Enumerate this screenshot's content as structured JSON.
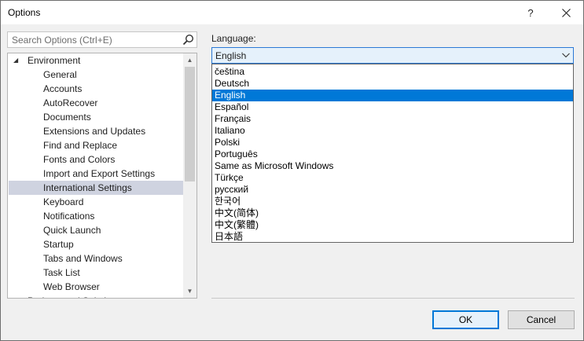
{
  "window": {
    "title": "Options",
    "help_label": "?",
    "close_label": "✕"
  },
  "search": {
    "placeholder": "Search Options (Ctrl+E)"
  },
  "tree": {
    "root": "Environment",
    "items": [
      "General",
      "Accounts",
      "AutoRecover",
      "Documents",
      "Extensions and Updates",
      "Find and Replace",
      "Fonts and Colors",
      "Import and Export Settings",
      "International Settings",
      "Keyboard",
      "Notifications",
      "Quick Launch",
      "Startup",
      "Tabs and Windows",
      "Task List",
      "Web Browser"
    ],
    "selected": "International Settings",
    "partial": "Projects and Solutions"
  },
  "language": {
    "label": "Language:",
    "value": "English",
    "options": [
      "čeština",
      "Deutsch",
      "English",
      "Español",
      "Français",
      "Italiano",
      "Polski",
      "Português",
      "Same as Microsoft Windows",
      "Türkçe",
      "русский",
      "한국어",
      "中文(简体)",
      "中文(繁體)",
      "日本語"
    ],
    "selected": "English"
  },
  "buttons": {
    "ok": "OK",
    "cancel": "Cancel"
  },
  "colors": {
    "selection": "#0078d7",
    "tree_selection": "#cfd3e0",
    "combo_focus": "#e5f1fb"
  }
}
